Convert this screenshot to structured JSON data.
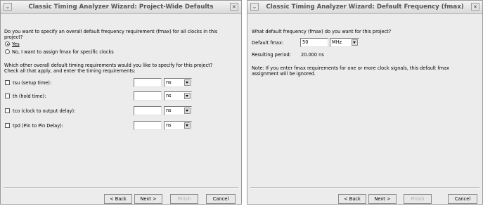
{
  "left": {
    "title": "Classic Timing Analyzer Wizard: Project-Wide Defaults",
    "question_line1": "Do you want to specify an overall default frequency requirement (fmax) for all clocks in this",
    "question_line2": "project?",
    "radio_yes": "Yes",
    "radio_no": "No, I want to assign fmax for specific clocks",
    "radio_selected": "yes",
    "other_line1": "Which other overall default timing requirements would you like to specify for this project?",
    "other_line2": "Check all that apply, and enter the timing requirements:",
    "requirements": [
      {
        "label": "tsu (setup time):",
        "value": "",
        "unit": "ns",
        "checked": false
      },
      {
        "label": "th (hold time):",
        "value": "",
        "unit": "ns",
        "checked": false
      },
      {
        "label": "tco (clock to output delay):",
        "value": "",
        "unit": "ns",
        "checked": false
      },
      {
        "label": "tpd (Pin to Pin Delay):",
        "value": "",
        "unit": "ns",
        "checked": false
      }
    ],
    "buttons": {
      "back": "< Back",
      "next": "Next >",
      "finish": "Finish",
      "cancel": "Cancel"
    }
  },
  "right": {
    "title": "Classic Timing Analyzer Wizard: Default Frequency (fmax)",
    "question": "What default frequency (fmax) do you want for this project?",
    "fmax_label": "Default fmax:",
    "fmax_value": "50",
    "fmax_unit": "MHz",
    "period_label": "Resulting period:",
    "period_value": "20.000 ns",
    "note_line1": "Note: If you enter fmax requirements for one or more clock signals, this default fmax",
    "note_line2": "assignment will be ignored.",
    "buttons": {
      "back": "< Back",
      "next": "Next >",
      "finish": "Finish",
      "cancel": "Cancel"
    }
  },
  "icons": {
    "window_menu": "chevron-down-icon",
    "window_close": "close-icon"
  },
  "colors": {
    "window_bg": "#ececec",
    "title_text": "#555555",
    "disabled_text": "#ababab"
  }
}
